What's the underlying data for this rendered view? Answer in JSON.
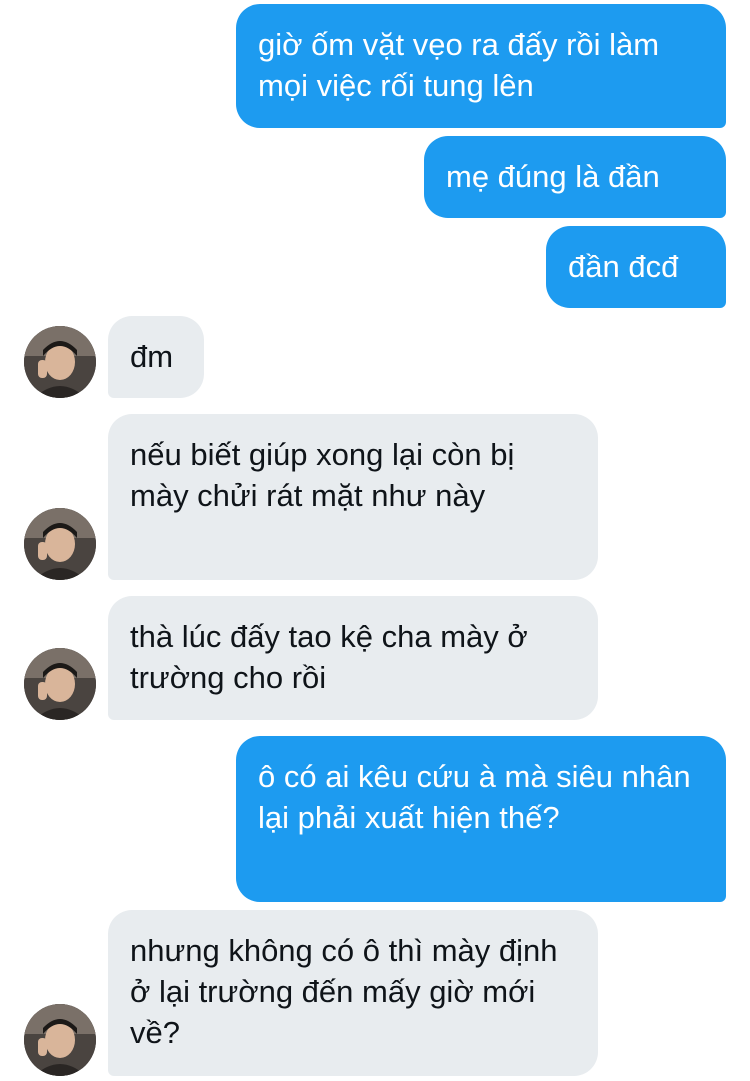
{
  "messages": [
    {
      "side": "sent",
      "text": "giờ ốm vặt vẹo ra đấy rồi làm mọi việc rối tung lên"
    },
    {
      "side": "sent",
      "text": "mẹ đúng là đần"
    },
    {
      "side": "sent",
      "text": "đần đcđ"
    },
    {
      "side": "received",
      "text": "đm"
    },
    {
      "side": "received",
      "text": "nếu biết giúp xong lại còn bị mày chửi rát mặt như này"
    },
    {
      "side": "received",
      "text": "thà lúc đấy tao kệ cha mày ở trường cho rồi"
    },
    {
      "side": "sent",
      "text": "ô có ai kêu cứu à mà siêu nhân lại phải xuất hiện thế?"
    },
    {
      "side": "received",
      "text": "nhưng không có ô thì mày định ở lại trường đến mấy giờ mới về?"
    }
  ],
  "colors": {
    "sent_bubble": "#1d9bf0",
    "received_bubble": "#e8ecef",
    "sent_text": "#ffffff",
    "received_text": "#0f1419"
  },
  "icons": {
    "avatar": "user-avatar-photo"
  }
}
